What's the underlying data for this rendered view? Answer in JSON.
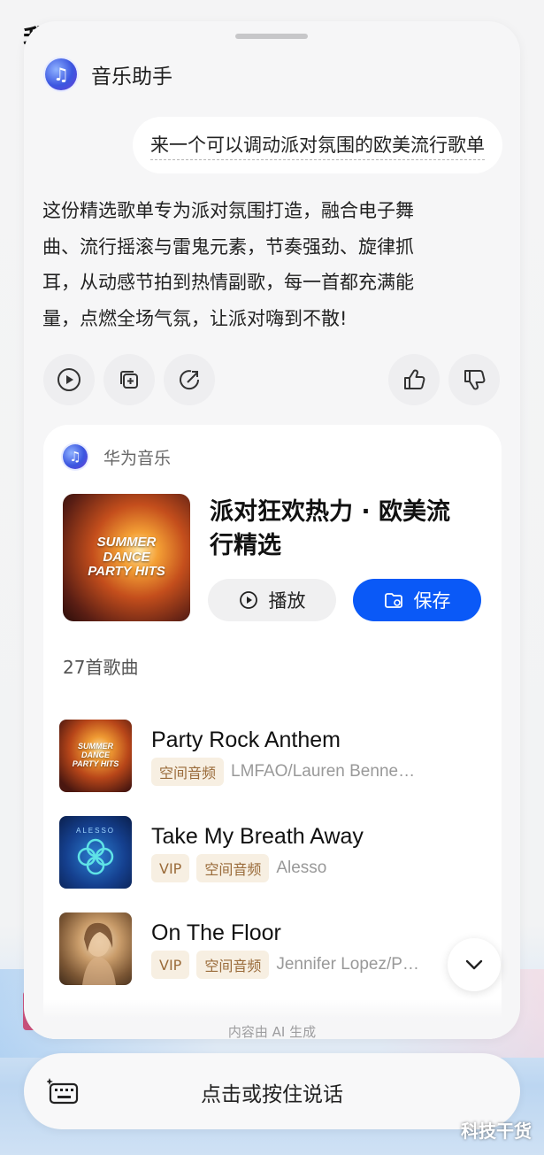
{
  "background": {
    "title_fragment": "我"
  },
  "header": {
    "assistant_name": "音乐助手"
  },
  "conversation": {
    "user_query": "来一个可以调动派对氛围的欧美流行歌单",
    "answer_lines": [
      "这份精选歌单专为派对氛围打造，融合电子舞",
      "曲、流行摇滚与雷鬼元素，节奏强劲、旋律抓",
      "耳，从动感节拍到热情副歌，每一首都充满能",
      "量，点燃全场气氛，让派对嗨到不散!"
    ]
  },
  "actions": [
    "play-icon",
    "copy-icon",
    "share-icon",
    "thumbs-up-icon",
    "thumbs-down-icon"
  ],
  "playlist_card": {
    "source": "华为音乐",
    "cover_text": [
      "SUMMER",
      "DANCE",
      "PARTY HITS"
    ],
    "title_lines": [
      "派对狂欢热力 · 欧美流",
      "行精选"
    ],
    "play_label": "播放",
    "save_label": "保存",
    "song_count": "27首歌曲",
    "songs": [
      {
        "title": "Party Rock Anthem",
        "tags": [
          "空间音频"
        ],
        "artist": "LMFAO/Lauren Benne…",
        "cover_text": [
          "SUMMER",
          "DANCE",
          "PARTY HITS"
        ]
      },
      {
        "title": "Take My Breath Away",
        "tags": [
          "VIP",
          "空间音频"
        ],
        "artist": "Alesso",
        "cover_text": [
          "ALESSO"
        ]
      },
      {
        "title": "On The Floor",
        "tags": [
          "VIP",
          "空间音频"
        ],
        "artist": "Jennifer Lopez/P…"
      }
    ]
  },
  "footer": {
    "ai_note": "内容由 AI 生成",
    "voice_prompt": "点击或按住说话"
  },
  "watermark": "科技干货",
  "colors": {
    "accent": "#0a59f7",
    "tag_bg": "#f7efe2",
    "tag_text": "#9a6b3a"
  }
}
